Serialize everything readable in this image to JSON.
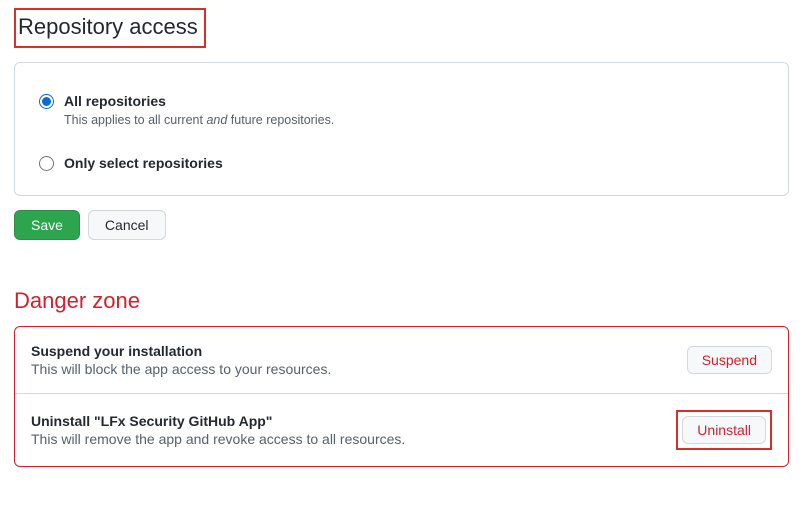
{
  "sections": {
    "repoAccess": {
      "heading": "Repository access",
      "options": {
        "all": {
          "label": "All repositories",
          "desc_prefix": "This applies to all current ",
          "desc_em": "and",
          "desc_suffix": " future repositories."
        },
        "select": {
          "label": "Only select repositories"
        }
      }
    },
    "actions": {
      "save": "Save",
      "cancel": "Cancel"
    },
    "danger": {
      "heading": "Danger zone",
      "suspend": {
        "title": "Suspend your installation",
        "desc": "This will block the app access to your resources.",
        "button": "Suspend"
      },
      "uninstall": {
        "title": "Uninstall \"LFx Security GitHub App\"",
        "desc": "This will remove the app and revoke access to all resources.",
        "button": "Uninstall"
      }
    }
  }
}
